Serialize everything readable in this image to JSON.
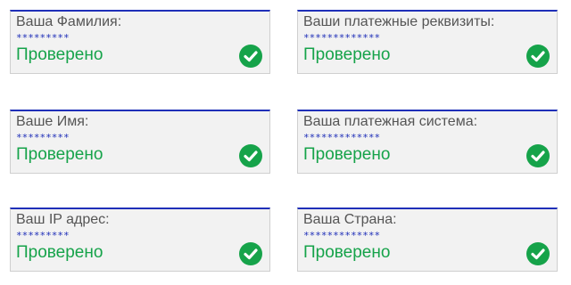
{
  "colors": {
    "accent_border": "#1f2fb8",
    "mask_text": "#1f2fb8",
    "status_text": "#16a34a",
    "check_fill": "#16a34a",
    "card_bg": "#f2f2f2",
    "label_text": "#555555"
  },
  "fields": [
    {
      "label": "Ваша Фамилия:",
      "mask": "*********",
      "status": "Проверено",
      "icon": "check-circle-icon"
    },
    {
      "label": "Ваши платежные реквизиты:",
      "mask": "*************",
      "status": "Проверено",
      "icon": "check-circle-icon"
    },
    {
      "label": "Ваше Имя:",
      "mask": "*********",
      "status": "Проверено",
      "icon": "check-circle-icon"
    },
    {
      "label": "Ваша платежная система:",
      "mask": "*************",
      "status": "Проверено",
      "icon": "check-circle-icon"
    },
    {
      "label": "Ваш IP адрес:",
      "mask": "*********",
      "status": "Проверено",
      "icon": "check-circle-icon"
    },
    {
      "label": "Ваша Страна:",
      "mask": "*************",
      "status": "Проверено",
      "icon": "check-circle-icon"
    }
  ]
}
